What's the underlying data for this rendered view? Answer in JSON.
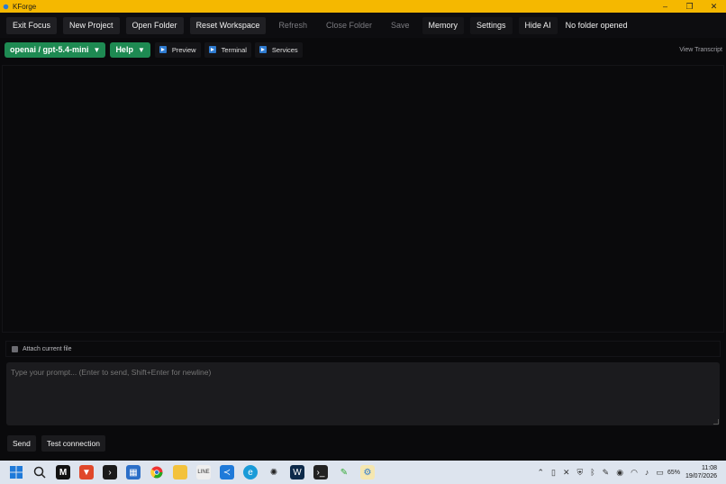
{
  "window": {
    "title": "KForge",
    "minimize": "–",
    "maximize": "❐",
    "close": "✕"
  },
  "toolbar": {
    "exit_focus": "Exit Focus",
    "new_project": "New Project",
    "open_folder": "Open Folder",
    "reset_workspace": "Reset Workspace",
    "refresh": "Refresh",
    "close_folder": "Close Folder",
    "save": "Save",
    "memory": "Memory",
    "settings": "Settings",
    "hide_ai": "Hide AI",
    "folder_status": "No folder opened"
  },
  "row2": {
    "model": "openai / gpt-5.4-mini",
    "help": "Help",
    "caret": "▼",
    "preview": "Preview",
    "terminal": "Terminal",
    "services": "Services",
    "view_transcript": "View Transcript"
  },
  "composer": {
    "attach_label": "Attach current file",
    "placeholder": "Type your prompt... (Enter to send, Shift+Enter for newline)",
    "send": "Send",
    "test_connection": "Test connection"
  },
  "taskbar": {
    "battery": "65%",
    "time": "11:08",
    "date": "19/07/2026",
    "icons": [
      "windows-start",
      "search",
      "m-app",
      "brave",
      "powershell",
      "store",
      "chrome",
      "file-explorer",
      "line-app",
      "vscode",
      "edge",
      "chatgpt",
      "webstorm",
      "terminal",
      "paint",
      "kforge"
    ]
  },
  "colors": {
    "titlebar": "#f5b800",
    "accent_green": "#1e8a52",
    "play_blue": "#2f7bd0"
  }
}
